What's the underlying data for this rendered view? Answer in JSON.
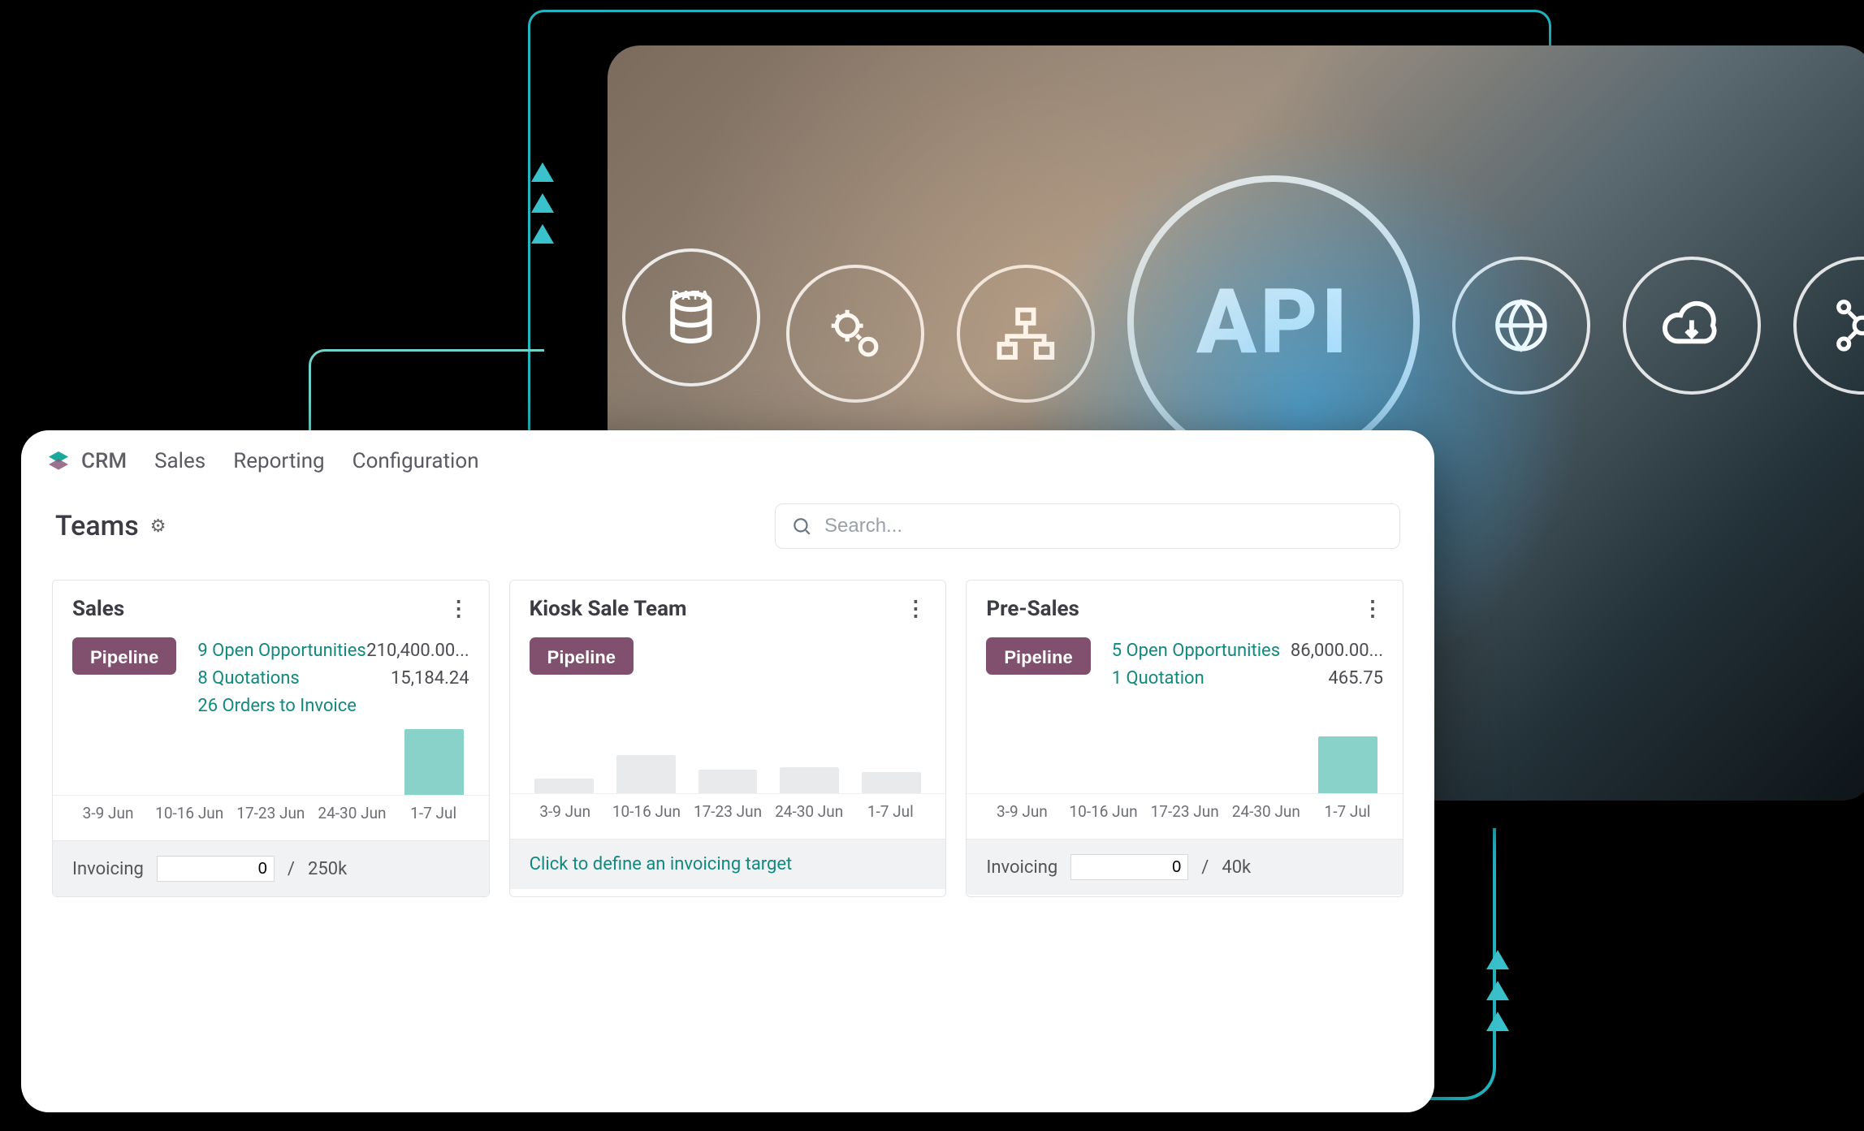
{
  "background_icons": {
    "data_label": "DATA",
    "api_label": "API"
  },
  "crm": {
    "app_name": "CRM",
    "nav": {
      "sales": "Sales",
      "reporting": "Reporting",
      "configuration": "Configuration"
    },
    "page_title": "Teams",
    "search_placeholder": "Search...",
    "chart_dates": [
      "3-9 Jun",
      "10-16 Jun",
      "17-23 Jun",
      "24-30 Jun",
      "1-7 Jul"
    ],
    "pipeline_label": "Pipeline",
    "invoicing_label": "Invoicing",
    "define_target_label": "Click to define an invoicing target",
    "cards": {
      "sales": {
        "title": "Sales",
        "links": [
          {
            "label": "9 Open Opportunities",
            "value": "210,400.00..."
          },
          {
            "label": "8 Quotations",
            "value": "15,184.24"
          },
          {
            "label": "26 Orders to Invoice",
            "value": ""
          }
        ],
        "footer": {
          "input_value": "0",
          "sep": "/",
          "target": "250k"
        }
      },
      "kiosk": {
        "title": "Kiosk Sale Team"
      },
      "presales": {
        "title": "Pre-Sales",
        "links": [
          {
            "label": "5 Open Opportunities",
            "value": "86,000.00..."
          },
          {
            "label": "1 Quotation",
            "value": "465.75"
          }
        ],
        "footer": {
          "input_value": "0",
          "sep": "/",
          "target": "40k"
        }
      }
    }
  },
  "chart_data": [
    {
      "type": "bar",
      "title": "Sales",
      "categories": [
        "3-9 Jun",
        "10-16 Jun",
        "17-23 Jun",
        "24-30 Jun",
        "1-7 Jul"
      ],
      "values": [
        0,
        0,
        0,
        0,
        55
      ],
      "highlight_index": 4,
      "ylim": [
        0,
        60
      ],
      "xlabel": "",
      "ylabel": ""
    },
    {
      "type": "bar",
      "title": "Kiosk Sale Team",
      "categories": [
        "3-9 Jun",
        "10-16 Jun",
        "17-23 Jun",
        "24-30 Jun",
        "1-7 Jul"
      ],
      "values": [
        12,
        32,
        20,
        22,
        18
      ],
      "highlight_index": null,
      "ylim": [
        0,
        60
      ],
      "xlabel": "",
      "ylabel": ""
    },
    {
      "type": "bar",
      "title": "Pre-Sales",
      "categories": [
        "3-9 Jun",
        "10-16 Jun",
        "17-23 Jun",
        "24-30 Jun",
        "1-7 Jul"
      ],
      "values": [
        0,
        0,
        0,
        0,
        48
      ],
      "highlight_index": 4,
      "ylim": [
        0,
        60
      ],
      "xlabel": "",
      "ylabel": ""
    }
  ]
}
